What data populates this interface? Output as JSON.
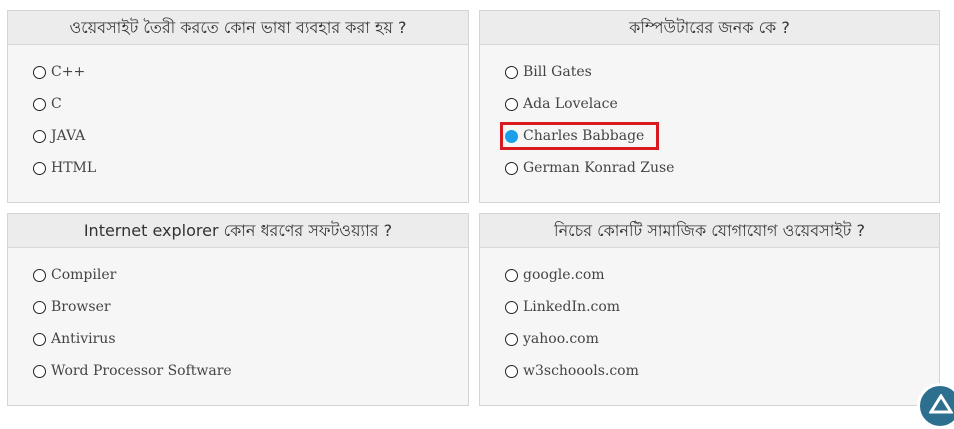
{
  "questions": [
    {
      "title": "ওয়েবসাইট তৈরী করতে কোন ভাষা ব্যবহার করা হয় ?",
      "options": [
        {
          "label": "C++",
          "selected": false
        },
        {
          "label": "C",
          "selected": false
        },
        {
          "label": "JAVA",
          "selected": false
        },
        {
          "label": "HTML",
          "selected": false
        }
      ]
    },
    {
      "title": "কম্পিউটারের জনক কে ?",
      "options": [
        {
          "label": "Bill Gates",
          "selected": false
        },
        {
          "label": "Ada Lovelace",
          "selected": false
        },
        {
          "label": "Charles Babbage",
          "selected": true
        },
        {
          "label": "German Konrad Zuse",
          "selected": false
        }
      ]
    },
    {
      "title": "Internet explorer কোন ধরণের সফটওয়্যার ?",
      "options": [
        {
          "label": "Compiler",
          "selected": false
        },
        {
          "label": "Browser",
          "selected": false
        },
        {
          "label": "Antivirus",
          "selected": false
        },
        {
          "label": "Word Processor Software",
          "selected": false
        }
      ]
    },
    {
      "title": "নিচের কোনটি সামাজিক যোগাযোগ ওয়েবসাইট ?",
      "options": [
        {
          "label": "google.com",
          "selected": false
        },
        {
          "label": "LinkedIn.com",
          "selected": false
        },
        {
          "label": "yahoo.com",
          "selected": false
        },
        {
          "label": "w3schoools.com",
          "selected": false
        }
      ]
    }
  ],
  "colors": {
    "selected_radio": "#1aa0e8",
    "highlight_border": "#d9191f",
    "card_background": "#f6f6f6",
    "header_background": "#ececec",
    "scroll_button": "#2c6f8f"
  },
  "icons": {
    "scroll_top": "arrow-up-icon"
  }
}
